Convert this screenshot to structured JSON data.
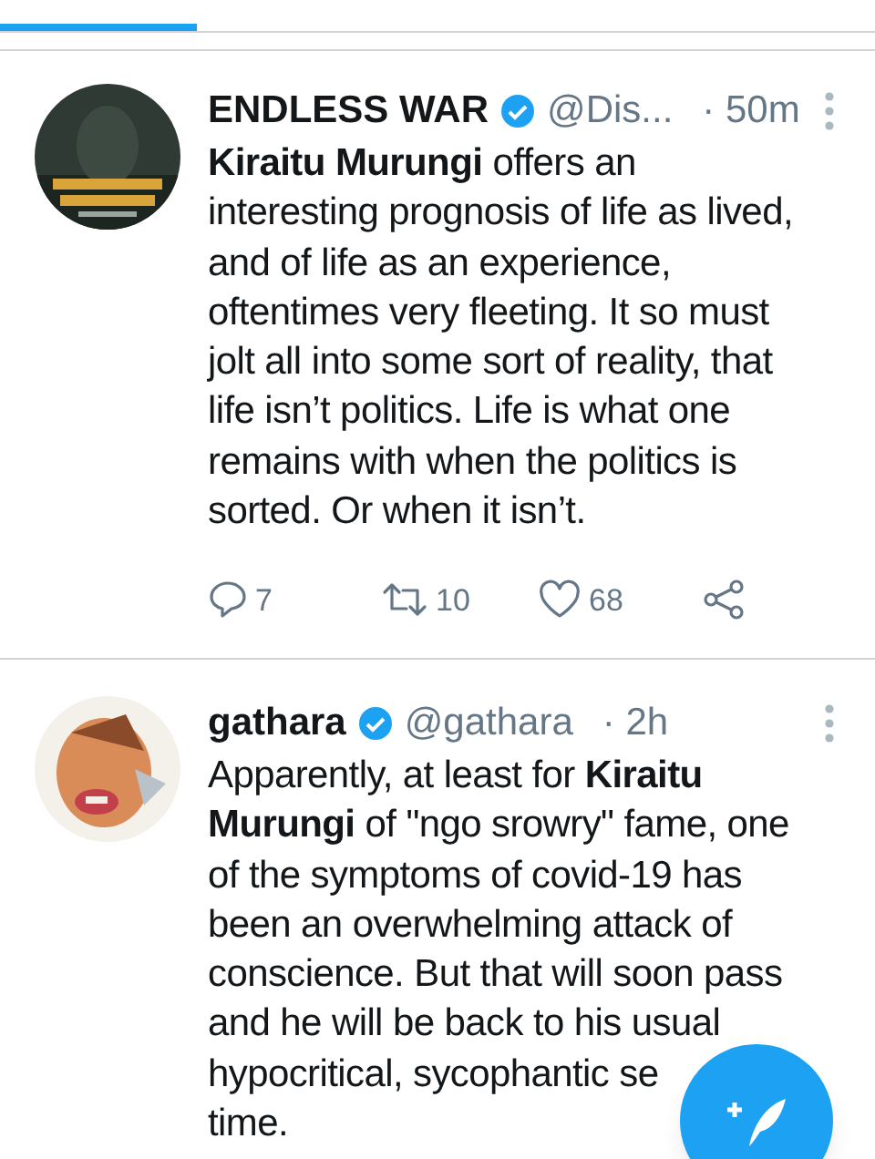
{
  "tabs": [
    {
      "selected": true
    }
  ],
  "tweets": [
    {
      "name": "ENDLESS WAR",
      "verified": true,
      "handle": "@Dis...",
      "time": "· 50m",
      "lines": [
        "**Kiraitu Murungi** offers an",
        "interesting prognosis of life as lived,",
        "and of life as an experience,",
        "oftentimes very fleeting. It so must",
        "jolt all into some sort of reality, that",
        "life isn’t politics. Life is what one",
        "remains with when the politics is",
        "sorted. Or when it isn’t."
      ],
      "actions": {
        "replies": "7",
        "retweets": "10",
        "likes": "68"
      }
    },
    {
      "name": "gathara",
      "verified": true,
      "handle": "@gathara",
      "time": "· 2h",
      "lines": [
        "Apparently, at least for **Kiraitu**",
        "**Murungi** of \"ngo srowry\" fame, one",
        "of the symptoms of covid-19 has",
        "been an overwhelming attack of",
        "conscience. But that will soon pass",
        "and he will be back to his usual",
        "hypocritical, sycophantic se",
        "time."
      ]
    }
  ]
}
